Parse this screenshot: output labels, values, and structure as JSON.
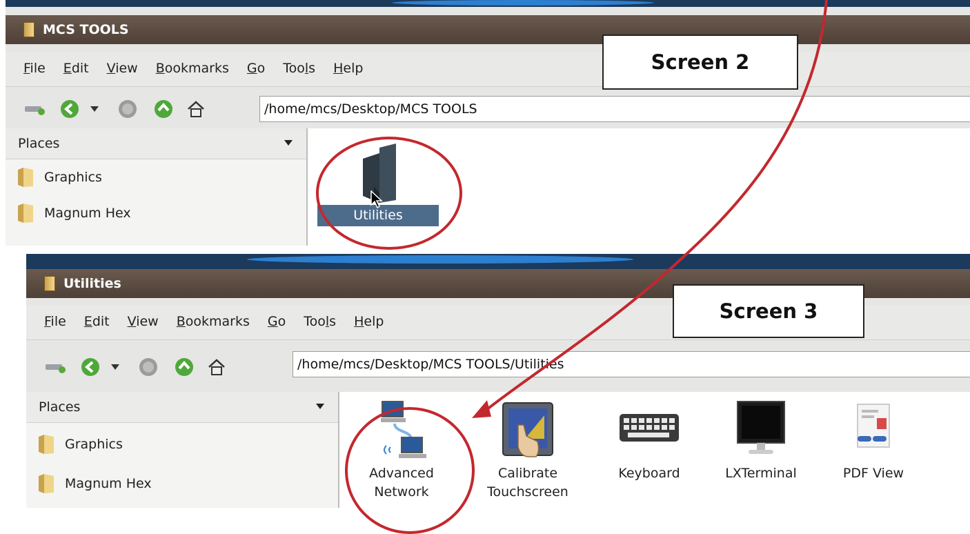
{
  "screen2": {
    "title": "MCS TOOLS",
    "menu": [
      {
        "pre": "",
        "u": "F",
        "post": "ile"
      },
      {
        "pre": "",
        "u": "E",
        "post": "dit"
      },
      {
        "pre": "",
        "u": "V",
        "post": "iew"
      },
      {
        "pre": "",
        "u": "B",
        "post": "ookmarks"
      },
      {
        "pre": "",
        "u": "G",
        "post": "o"
      },
      {
        "pre": "Too",
        "u": "l",
        "post": "s"
      },
      {
        "pre": "",
        "u": "H",
        "post": "elp"
      }
    ],
    "path": "/home/mcs/Desktop/MCS TOOLS",
    "places_label": "Places",
    "places": [
      "Graphics",
      "Magnum Hex"
    ],
    "items": [
      {
        "label": "Utilities",
        "icon": "folder-icon",
        "selected": true
      }
    ],
    "callout": "Screen 2"
  },
  "screen3": {
    "title": "Utilities",
    "menu": [
      {
        "pre": "",
        "u": "F",
        "post": "ile"
      },
      {
        "pre": "",
        "u": "E",
        "post": "dit"
      },
      {
        "pre": "",
        "u": "V",
        "post": "iew"
      },
      {
        "pre": "",
        "u": "B",
        "post": "ookmarks"
      },
      {
        "pre": "",
        "u": "G",
        "post": "o"
      },
      {
        "pre": "Too",
        "u": "l",
        "post": "s"
      },
      {
        "pre": "",
        "u": "H",
        "post": "elp"
      }
    ],
    "path": "/home/mcs/Desktop/MCS TOOLS/Utilities",
    "places_label": "Places",
    "places": [
      "Graphics",
      "Magnum Hex"
    ],
    "items": [
      {
        "line1": "Advanced",
        "line2": "Network",
        "icon": "network-computers-icon"
      },
      {
        "line1": "Calibrate",
        "line2": "Touchscreen",
        "icon": "touchscreen-calibrate-icon"
      },
      {
        "line1": "Keyboard",
        "line2": "",
        "icon": "keyboard-icon"
      },
      {
        "line1": "LXTerminal",
        "line2": "",
        "icon": "monitor-icon"
      },
      {
        "line1": "PDF View",
        "line2": "",
        "icon": "pdf-document-icon"
      }
    ],
    "callout": "Screen 3"
  },
  "colors": {
    "annotation": "#c3282e",
    "titlebar": "#5a4a40",
    "selection": "#4d6c8c"
  }
}
